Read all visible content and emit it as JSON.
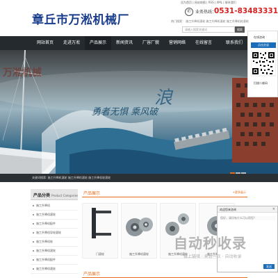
{
  "header": {
    "logo_text": "章丘市万淞机械厂",
    "top_links": "设为首页 | 网站地图 | RSS | XML | 联系我们",
    "hotline_icon": "phone-icon",
    "hotline_label": "业务热线：",
    "hotline_number": "0531-83483331",
    "hot_search": "热门搜索： 施工升降机滚轮   施工升降机滚轮   施工升降机轮滚轮",
    "search_placeholder": "请输入搜索关键词",
    "search_button": "搜索"
  },
  "nav": {
    "items": [
      {
        "label": "网站首页"
      },
      {
        "label": "走进万淞"
      },
      {
        "label": "产品展示"
      },
      {
        "label": "新闻资讯"
      },
      {
        "label": "厂容厂貌"
      },
      {
        "label": "营销网络"
      },
      {
        "label": "在线留言"
      },
      {
        "label": "联系我们"
      }
    ],
    "active_index": 2
  },
  "banner": {
    "brand_text": "万淞机械",
    "slogan": "勇者无惧  乘风破",
    "big_char": "浪",
    "slides": 3,
    "active_slide": 0
  },
  "breadcrumb": {
    "text": "关键词搜索:  施工升降机滚轮   施工升降机滚轮   施工升降机轮滚轮"
  },
  "sidebar": {
    "title": "产品分类",
    "subtitle": "Product Categories",
    "items": [
      {
        "label": "施工升降机"
      },
      {
        "label": "施工升降机滚轮"
      },
      {
        "label": "施工升降机配件"
      },
      {
        "label": "施工升降机导轮滚轮"
      },
      {
        "label": "施工升降机轮"
      },
      {
        "label": "施工升降机滚轮"
      },
      {
        "label": "施工升降机配件"
      },
      {
        "label": "施工升降机滚轮"
      }
    ]
  },
  "products": {
    "title": "产品展示",
    "more": "+更多展示",
    "items": [
      {
        "name": "门滚轮"
      },
      {
        "name": "施工升降机滚轮"
      },
      {
        "name": "施工升降机滚轮"
      },
      {
        "name": "施工升降机滚轮"
      }
    ],
    "second_title": "产品展示"
  },
  "side_panel": {
    "label": "在线咨询",
    "button": "点击交谈",
    "qr_caption": "扫描二维码"
  },
  "chat": {
    "title": "欢迎您来咨询",
    "input_text": "您好，请问有什么可以帮您？",
    "close": "×",
    "send": "发送"
  },
  "watermark": {
    "main": "自动秒收录",
    "sub": "做上链接 · 来访一次 · 自动收录"
  },
  "colors": {
    "brand_blue": "#1a3c8c",
    "hotline_red": "#d62020",
    "accent_orange": "#e86c1a",
    "nav_dark": "#242a2e"
  }
}
